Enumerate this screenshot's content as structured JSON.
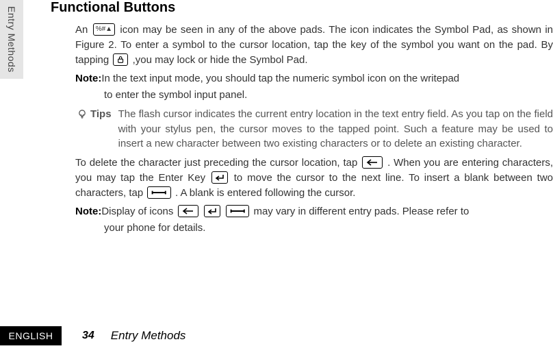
{
  "sideTab": "Entry Methods",
  "heading": "Functional Buttons",
  "para1a": "An",
  "para1b": "icon may be seen in any of the above pads. The icon indicates the Symbol Pad, as shown in Figure 2. To enter a symbol to the cursor location, tap the key of the symbol you want on the pad. By tapping",
  "para1c": ",you may lock or hide the Symbol Pad.",
  "noteLabel": "Note:",
  "note1a": "In the text input mode, you should tap the numeric symbol icon on the writepad",
  "note1b": "to enter the symbol input panel.",
  "tipsLabel": "Tips",
  "tipsText": "The flash cursor indicates the current entry location in the text entry field. As you tap on the field with your stylus pen, the cursor moves to the tapped point. Such a feature may be used to insert a new character between two existing characters or to delete an existing character.",
  "para2a": "To delete the character just preceding the cursor location, tap",
  "para2b": ". When you are entering characters, you may tap the Enter Key",
  "para2c": "to move the cursor to the next line. To insert a blank between two characters, tap",
  "para2d": ". A blank is entered following the cursor.",
  "note2a": "Display of icons",
  "note2b": "may vary in different entry pads. Please refer to",
  "note2c": "your phone for details.",
  "footer": {
    "lang": "ENGLISH",
    "page": "34",
    "section": "Entry Methods"
  },
  "icons": {
    "symbol": "%#▲",
    "lock": "lock-icon",
    "back": "back-arrow-icon",
    "enter": "enter-key-icon",
    "space": "space-bar-icon",
    "bulb": "lightbulb-icon"
  }
}
